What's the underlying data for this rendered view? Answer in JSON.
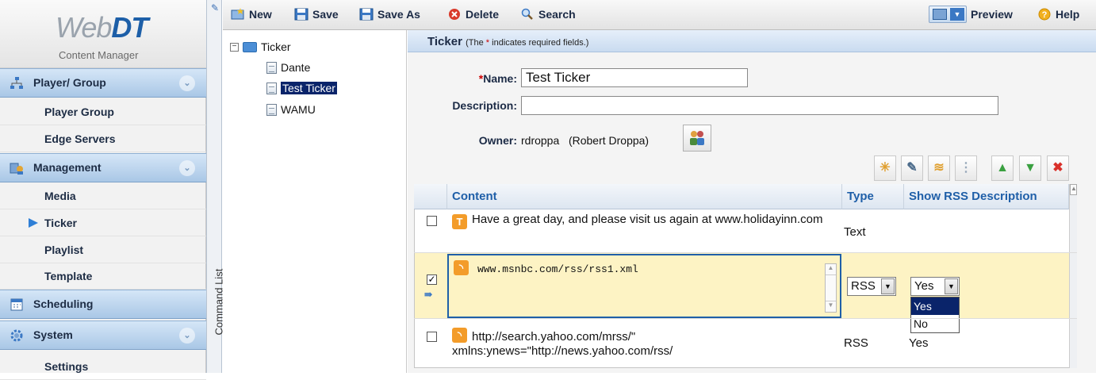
{
  "logo": {
    "brand_light": "Web",
    "brand_bold": "DT",
    "subtitle": "Content Manager"
  },
  "nav": {
    "sections": [
      {
        "label": "Player/ Group",
        "items": [
          "Player Group",
          "Edge Servers"
        ]
      },
      {
        "label": "Management",
        "items": [
          "Media",
          "Ticker",
          "Playlist",
          "Template"
        ]
      },
      {
        "label": "Scheduling",
        "items": []
      },
      {
        "label": "System",
        "items": [
          "Settings"
        ]
      }
    ],
    "active_item": "Ticker"
  },
  "command_list_label": "Command List",
  "toolbar": {
    "new": "New",
    "save": "Save",
    "save_as": "Save As",
    "delete": "Delete",
    "search": "Search",
    "preview": "Preview",
    "help": "Help"
  },
  "tree": {
    "root": "Ticker",
    "root_expander": "−",
    "children": [
      "Dante",
      "Test Ticker",
      "WAMU"
    ],
    "selected": "Test Ticker"
  },
  "form": {
    "header_title": "Ticker",
    "header_note_pre": "(The ",
    "header_note_star": "*",
    "header_note_post": " indicates required fields.)",
    "required_star": "*",
    "name_label": "Name:",
    "name_value": "Test Ticker",
    "description_label": "Description:",
    "description_value": "",
    "owner_label": "Owner:",
    "owner_value": "rdroppa",
    "owner_fullname": "(Robert Droppa)"
  },
  "grid": {
    "columns": [
      "Content",
      "Type",
      "Show RSS Description"
    ],
    "rows": [
      {
        "checked": false,
        "icon": "text-icon",
        "content": "Have a great day, and please visit us again at www.holidayinn.com",
        "type": "Text",
        "show_rss": ""
      },
      {
        "checked": true,
        "editing": true,
        "icon": "rss-icon",
        "content": "www.msnbc.com/rss/rss1.xml",
        "type": "RSS",
        "show_rss": "Yes",
        "dropdown_options": [
          "Yes",
          "No"
        ]
      },
      {
        "checked": false,
        "icon": "rss-icon",
        "content": "http://search.yahoo.com/mrss/\" xmlns:ynews=\"http://news.yahoo.com/rss/",
        "type": "RSS",
        "show_rss": "Yes"
      }
    ]
  },
  "colors": {
    "accent": "#1f5fa8",
    "edit_row": "#fdf3c4",
    "selection": "#0a246a"
  }
}
